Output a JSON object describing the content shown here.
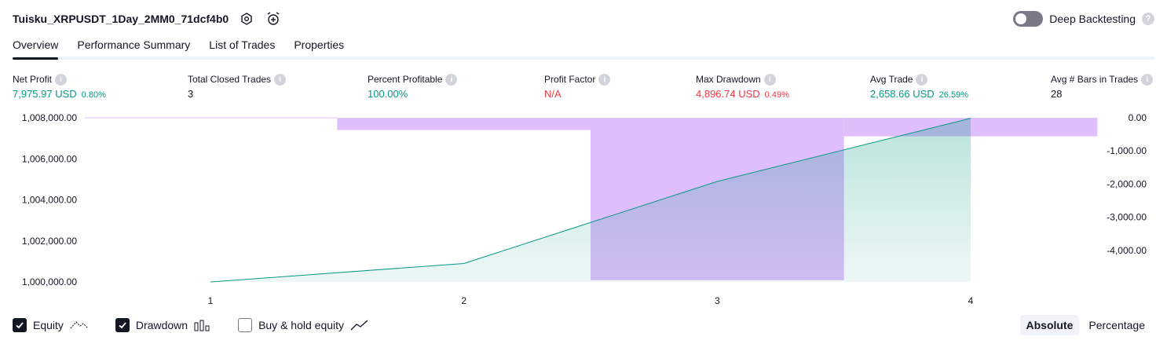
{
  "header": {
    "title": "Tuisku_XRPUSDT_1Day_2MM0_71dcf4b0",
    "deep_backtesting_label": "Deep Backtesting",
    "deep_backtesting_on": false
  },
  "tabs": [
    {
      "label": "Overview",
      "active": true
    },
    {
      "label": "Performance Summary",
      "active": false
    },
    {
      "label": "List of Trades",
      "active": false
    },
    {
      "label": "Properties",
      "active": false
    }
  ],
  "metrics": {
    "net_profit": {
      "label": "Net Profit",
      "value": "7,975.97 USD",
      "pct": "0.80%"
    },
    "total_closed_trades": {
      "label": "Total Closed Trades",
      "value": "3"
    },
    "percent_profitable": {
      "label": "Percent Profitable",
      "value": "100.00%"
    },
    "profit_factor": {
      "label": "Profit Factor",
      "value": "N/A"
    },
    "max_drawdown": {
      "label": "Max Drawdown",
      "value": "4,896.74 USD",
      "pct": "0.49%"
    },
    "avg_trade": {
      "label": "Avg Trade",
      "value": "2,658.66 USD",
      "pct": "26.59%"
    },
    "avg_bars": {
      "label": "Avg # Bars in Trades",
      "value": "28"
    }
  },
  "colors": {
    "equity_line": "#089981",
    "drawdown_fill": "#d9b3fb",
    "positive": "#089981",
    "negative": "#f23645"
  },
  "chart_data": {
    "type": "area",
    "x": [
      1,
      2,
      3,
      4
    ],
    "x_tick_labels": [
      "1",
      "2",
      "3",
      "4"
    ],
    "left_axis": {
      "ticks": [
        1000000,
        1002000,
        1004000,
        1006000,
        1008000
      ],
      "tick_labels": [
        "1,000,000.00",
        "1,002,000.00",
        "1,004,000.00",
        "1,006,000.00",
        "1,008,000.00"
      ],
      "ylim": [
        1000000,
        1008000
      ]
    },
    "right_axis": {
      "ticks": [
        0,
        -1000,
        -2000,
        -3000,
        -4000
      ],
      "tick_labels": [
        "0.00",
        "-1,000.00",
        "-2,000.00",
        "-3,000.00",
        "-4,000.00"
      ],
      "ylim": [
        -4950,
        0
      ],
      "inverted": true
    },
    "equity": {
      "x": [
        1,
        2,
        3,
        4
      ],
      "values": [
        1000000,
        1000900,
        1004900,
        1007976
      ]
    },
    "drawdown": [
      {
        "x_start": 0.5,
        "x_end": 1.5,
        "value": 0
      },
      {
        "x_start": 1.5,
        "x_end": 2.5,
        "value": -370
      },
      {
        "x_start": 2.5,
        "x_end": 3.5,
        "value": -4896.74
      },
      {
        "x_start": 3.5,
        "x_end": 4.5,
        "value": -560
      }
    ],
    "grid": false
  },
  "legend": {
    "equity": {
      "label": "Equity",
      "checked": true
    },
    "drawdown": {
      "label": "Drawdown",
      "checked": true
    },
    "buy_hold": {
      "label": "Buy & hold equity",
      "checked": false
    }
  },
  "mode": {
    "absolute_label": "Absolute",
    "percentage_label": "Percentage",
    "active": "Absolute"
  }
}
